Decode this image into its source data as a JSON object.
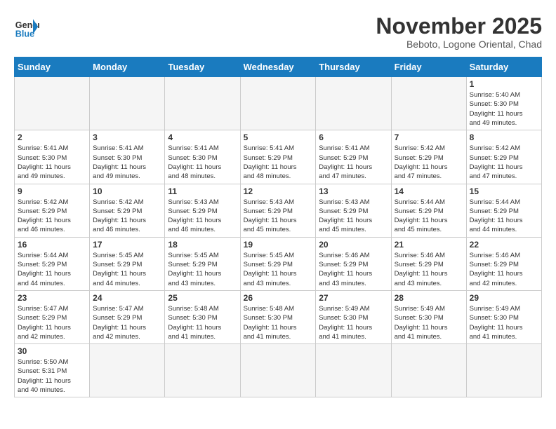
{
  "header": {
    "logo_general": "General",
    "logo_blue": "Blue",
    "month_title": "November 2025",
    "location": "Beboto, Logone Oriental, Chad"
  },
  "weekdays": [
    "Sunday",
    "Monday",
    "Tuesday",
    "Wednesday",
    "Thursday",
    "Friday",
    "Saturday"
  ],
  "weeks": [
    [
      {
        "day": null,
        "info": null
      },
      {
        "day": null,
        "info": null
      },
      {
        "day": null,
        "info": null
      },
      {
        "day": null,
        "info": null
      },
      {
        "day": null,
        "info": null
      },
      {
        "day": null,
        "info": null
      },
      {
        "day": "1",
        "info": "Sunrise: 5:40 AM\nSunset: 5:30 PM\nDaylight: 11 hours\nand 49 minutes."
      }
    ],
    [
      {
        "day": "2",
        "info": "Sunrise: 5:41 AM\nSunset: 5:30 PM\nDaylight: 11 hours\nand 49 minutes."
      },
      {
        "day": "3",
        "info": "Sunrise: 5:41 AM\nSunset: 5:30 PM\nDaylight: 11 hours\nand 49 minutes."
      },
      {
        "day": "4",
        "info": "Sunrise: 5:41 AM\nSunset: 5:30 PM\nDaylight: 11 hours\nand 48 minutes."
      },
      {
        "day": "5",
        "info": "Sunrise: 5:41 AM\nSunset: 5:29 PM\nDaylight: 11 hours\nand 48 minutes."
      },
      {
        "day": "6",
        "info": "Sunrise: 5:41 AM\nSunset: 5:29 PM\nDaylight: 11 hours\nand 47 minutes."
      },
      {
        "day": "7",
        "info": "Sunrise: 5:42 AM\nSunset: 5:29 PM\nDaylight: 11 hours\nand 47 minutes."
      },
      {
        "day": "8",
        "info": "Sunrise: 5:42 AM\nSunset: 5:29 PM\nDaylight: 11 hours\nand 47 minutes."
      }
    ],
    [
      {
        "day": "9",
        "info": "Sunrise: 5:42 AM\nSunset: 5:29 PM\nDaylight: 11 hours\nand 46 minutes."
      },
      {
        "day": "10",
        "info": "Sunrise: 5:42 AM\nSunset: 5:29 PM\nDaylight: 11 hours\nand 46 minutes."
      },
      {
        "day": "11",
        "info": "Sunrise: 5:43 AM\nSunset: 5:29 PM\nDaylight: 11 hours\nand 46 minutes."
      },
      {
        "day": "12",
        "info": "Sunrise: 5:43 AM\nSunset: 5:29 PM\nDaylight: 11 hours\nand 45 minutes."
      },
      {
        "day": "13",
        "info": "Sunrise: 5:43 AM\nSunset: 5:29 PM\nDaylight: 11 hours\nand 45 minutes."
      },
      {
        "day": "14",
        "info": "Sunrise: 5:44 AM\nSunset: 5:29 PM\nDaylight: 11 hours\nand 45 minutes."
      },
      {
        "day": "15",
        "info": "Sunrise: 5:44 AM\nSunset: 5:29 PM\nDaylight: 11 hours\nand 44 minutes."
      }
    ],
    [
      {
        "day": "16",
        "info": "Sunrise: 5:44 AM\nSunset: 5:29 PM\nDaylight: 11 hours\nand 44 minutes."
      },
      {
        "day": "17",
        "info": "Sunrise: 5:45 AM\nSunset: 5:29 PM\nDaylight: 11 hours\nand 44 minutes."
      },
      {
        "day": "18",
        "info": "Sunrise: 5:45 AM\nSunset: 5:29 PM\nDaylight: 11 hours\nand 43 minutes."
      },
      {
        "day": "19",
        "info": "Sunrise: 5:45 AM\nSunset: 5:29 PM\nDaylight: 11 hours\nand 43 minutes."
      },
      {
        "day": "20",
        "info": "Sunrise: 5:46 AM\nSunset: 5:29 PM\nDaylight: 11 hours\nand 43 minutes."
      },
      {
        "day": "21",
        "info": "Sunrise: 5:46 AM\nSunset: 5:29 PM\nDaylight: 11 hours\nand 43 minutes."
      },
      {
        "day": "22",
        "info": "Sunrise: 5:46 AM\nSunset: 5:29 PM\nDaylight: 11 hours\nand 42 minutes."
      }
    ],
    [
      {
        "day": "23",
        "info": "Sunrise: 5:47 AM\nSunset: 5:29 PM\nDaylight: 11 hours\nand 42 minutes."
      },
      {
        "day": "24",
        "info": "Sunrise: 5:47 AM\nSunset: 5:29 PM\nDaylight: 11 hours\nand 42 minutes."
      },
      {
        "day": "25",
        "info": "Sunrise: 5:48 AM\nSunset: 5:30 PM\nDaylight: 11 hours\nand 41 minutes."
      },
      {
        "day": "26",
        "info": "Sunrise: 5:48 AM\nSunset: 5:30 PM\nDaylight: 11 hours\nand 41 minutes."
      },
      {
        "day": "27",
        "info": "Sunrise: 5:49 AM\nSunset: 5:30 PM\nDaylight: 11 hours\nand 41 minutes."
      },
      {
        "day": "28",
        "info": "Sunrise: 5:49 AM\nSunset: 5:30 PM\nDaylight: 11 hours\nand 41 minutes."
      },
      {
        "day": "29",
        "info": "Sunrise: 5:49 AM\nSunset: 5:30 PM\nDaylight: 11 hours\nand 41 minutes."
      }
    ],
    [
      {
        "day": "30",
        "info": "Sunrise: 5:50 AM\nSunset: 5:31 PM\nDaylight: 11 hours\nand 40 minutes."
      },
      {
        "day": null,
        "info": null
      },
      {
        "day": null,
        "info": null
      },
      {
        "day": null,
        "info": null
      },
      {
        "day": null,
        "info": null
      },
      {
        "day": null,
        "info": null
      },
      {
        "day": null,
        "info": null
      }
    ]
  ]
}
